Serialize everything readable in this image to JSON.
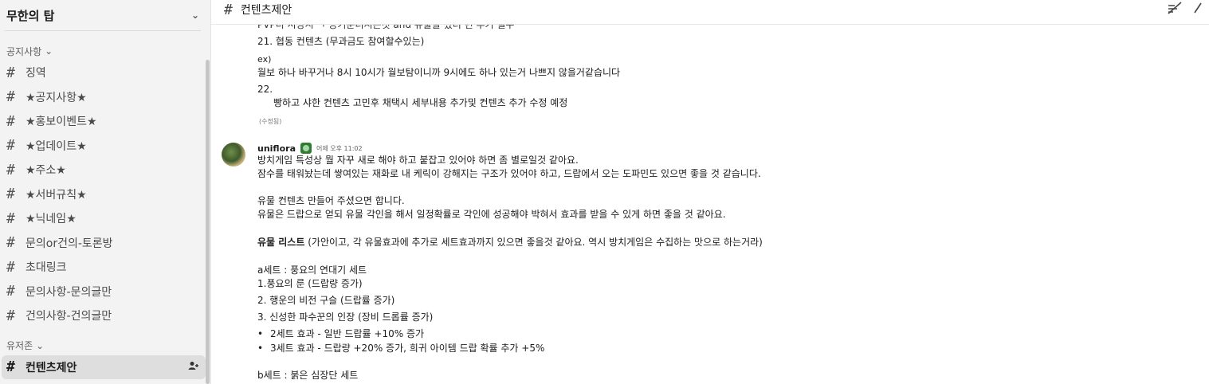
{
  "workspace": {
    "name": "무한의 탑"
  },
  "sidebar": {
    "section1": "공지사항",
    "channels": [
      "징역",
      "★공지사항★",
      "★홍보이벤트★",
      "★업데이트★",
      "★주소★",
      "★서버규칙★",
      "★닉네임★",
      "문의or건의-토론방",
      "초대링크",
      "문의사항-문의글만",
      "건의사항-건의글만"
    ],
    "section2": "유저존",
    "active_channel": "컨텐츠제안"
  },
  "header": {
    "channel": "컨텐츠제안"
  },
  "prev_message": {
    "cut_line": "PVP디 시상시 ㄱ 공기준더시는것 and 뉴물을 쳤더 던 추기 필수",
    "l1": "21. 협동 컨텐츠 (무과금도 참여할수있는)",
    "l2": "ex)",
    "l3": "월보 하나 바꾸거나 8시 10시가 월보탐이니까 9시에도 하나 있는거 나쁘지 않을거같습니다",
    "l4": "22.",
    "l5": "빵하고 샤한 컨텐츠 고민후 채택시  세부내용 추가및 컨텐츠 추가 수정 예정",
    "edited": "(수정됨)"
  },
  "message": {
    "author": "uniflora",
    "time": "어제 오후 11:02",
    "lines": [
      "방치게임 특성상 뭘 자꾸 새로 해야 하고 붙잡고 있어야 하면 좀 별로일것 같아요.",
      "잠수를 태워놨는데 쌓여있는 재화로 내 케릭이 강해지는 구조가 있어야 하고, 드랍에서 오는 도파민도 있으면 좋을 것 같습니다.",
      "유물 컨텐츠 만들어 주셨으면 합니다.",
      "유물은 드랍으로 얻되 유물 각인을 해서 일정확률로 각인에 성공해야 박혀서  효과를 받을 수 있게 하면 좋을 것 같아요.",
      "(가안이고, 각 유물효과에 추가로 세트효과까지 있으면 좋을것 같아요. 역시 방치게임은 수집하는 맛으로 하는거라)",
      "a세트 : 풍요의 연대기 세트",
      "1.풍요의 룬 (드랍량 증가)",
      "2. 행운의 비전 구슬 (드랍률 증가)",
      "3. 신성한 파수꾼의 인장 (장비 드롭률 증가)",
      "b세트 : 붉은 심장단 세트"
    ],
    "bold_label": "유물 리스트",
    "bullets": [
      "2세트 효과 - 일반 드랍률 +10% 증가",
      "3세트 효과 - 드랍량 +20% 증가, 희귀 아이템 드랍 확률 추가 +5%"
    ]
  }
}
